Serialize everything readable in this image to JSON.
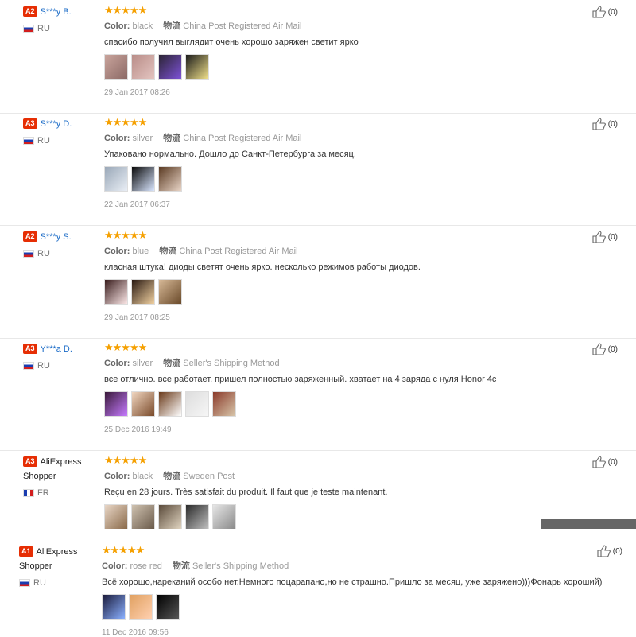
{
  "reviews": [
    {
      "badge": "A2",
      "user": "S***y B.",
      "country": "RU",
      "flag": "ru",
      "stars": "★★★★★",
      "color_label": "Color:",
      "color": "black",
      "shipping_label": "物流",
      "shipping": "China Post Registered Air Mail",
      "text": "спасибо получил выглядит очень хорошо заряжен светит ярко",
      "date": "29 Jan 2017 08:26",
      "helpful": "(0)"
    },
    {
      "badge": "A3",
      "user": "S***y D.",
      "country": "RU",
      "flag": "ru",
      "stars": "★★★★★",
      "color_label": "Color:",
      "color": "silver",
      "shipping_label": "物流",
      "shipping": "China Post Registered Air Mail",
      "text": "Упаковано нормально. Дошло до Санкт-Петербурга за месяц.",
      "date": "22 Jan 2017 06:37",
      "helpful": "(0)"
    },
    {
      "badge": "A2",
      "user": "S***y S.",
      "country": "RU",
      "flag": "ru",
      "stars": "★★★★★",
      "color_label": "Color:",
      "color": "blue",
      "shipping_label": "物流",
      "shipping": "China Post Registered Air Mail",
      "text": "класная штука! диоды светят очень ярко. несколько режимов работы диодов.",
      "date": "29 Jan 2017 08:25",
      "helpful": "(0)"
    },
    {
      "badge": "A3",
      "user": "Y***a D.",
      "country": "RU",
      "flag": "ru",
      "stars": "★★★★★",
      "color_label": "Color:",
      "color": "silver",
      "shipping_label": "物流",
      "shipping": "Seller's Shipping Method",
      "text": "все отлично. все работает. пришел полностью заряженный. хватает на 4 заряда с нуля Honor 4c",
      "date": "25 Dec 2016 19:49",
      "helpful": "(0)"
    },
    {
      "badge": "A3",
      "user": "AliExpress Shopper",
      "country": "FR",
      "flag": "fr",
      "stars": "★★★★★",
      "color_label": "Color:",
      "color": "black",
      "shipping_label": "物流",
      "shipping": "Sweden Post",
      "text": "Reçu en 28 jours. Très satisfait du produit. Il faut que je teste maintenant.",
      "date": "",
      "helpful": "(0)"
    },
    {
      "badge": "A1",
      "user": "AliExpress Shopper",
      "country": "RU",
      "flag": "ru",
      "stars": "★★★★★",
      "color_label": "Color:",
      "color": "rose red",
      "shipping_label": "物流",
      "shipping": "Seller's Shipping Method",
      "text": "Всё хорошо,нареканий особо нет.Немного поцарапано,но не страшно.Пришло за месяц, уже заряжено)))Фонарь хороший)",
      "date": "11 Dec 2016 09:56",
      "helpful": "(0)"
    }
  ]
}
